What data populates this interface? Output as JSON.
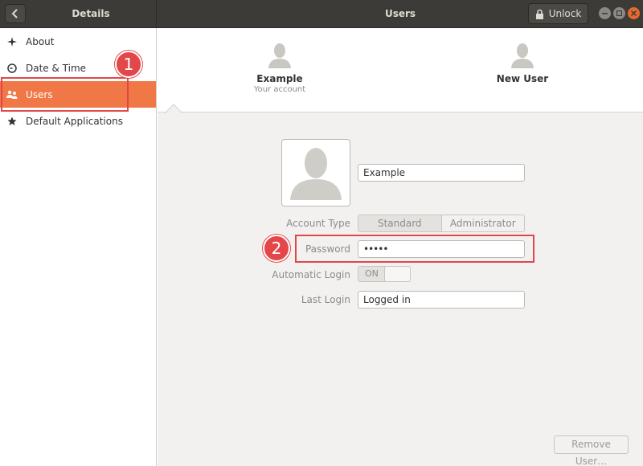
{
  "header": {
    "left_title": "Details",
    "main_title": "Users",
    "unlock_label": "Unlock"
  },
  "sidebar": {
    "items": [
      {
        "label": "About",
        "icon": "star-sparkle-icon"
      },
      {
        "label": "Date & Time",
        "icon": "clock-icon"
      },
      {
        "label": "Users",
        "icon": "users-icon",
        "active": true
      },
      {
        "label": "Default Applications",
        "icon": "star-icon"
      }
    ]
  },
  "users": [
    {
      "name": "Example",
      "subtitle": "Your account"
    },
    {
      "name": "New User",
      "subtitle": ""
    }
  ],
  "details": {
    "name_value": "Example",
    "account_type_label": "Account Type",
    "account_type_options": [
      "Standard",
      "Administrator"
    ],
    "account_type_selected": "Standard",
    "password_label": "Password",
    "password_value": "•••••",
    "automatic_login_label": "Automatic Login",
    "automatic_login_state": "ON",
    "last_login_label": "Last Login",
    "last_login_value": "Logged in"
  },
  "remove_user_label": "Remove User…",
  "annotations": {
    "callout_1": "1",
    "callout_2": "2"
  },
  "colors": {
    "accent": "#f07746",
    "headerbar": "#3c3b37",
    "callout": "#e4474a",
    "close_button": "#e66a2c"
  }
}
